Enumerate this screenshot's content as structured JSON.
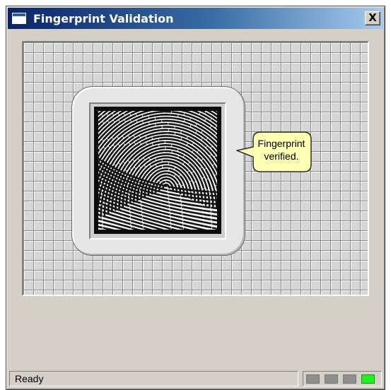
{
  "window": {
    "title": "Fingerprint Validation",
    "close_label": "X"
  },
  "sensor": {
    "callout_text": "Fingerprint verified.",
    "callout_color": "#ffffb4"
  },
  "status": {
    "text": "Ready",
    "leds": [
      {
        "state": "off",
        "color": "#8e8e8e"
      },
      {
        "state": "off",
        "color": "#8e8e8e"
      },
      {
        "state": "off",
        "color": "#8e8e8e"
      },
      {
        "state": "on",
        "color": "#22ee22"
      }
    ]
  },
  "colors": {
    "titlebar_start": "#0a246a",
    "titlebar_end": "#a6caf0",
    "window_face": "#d4d0c8"
  }
}
